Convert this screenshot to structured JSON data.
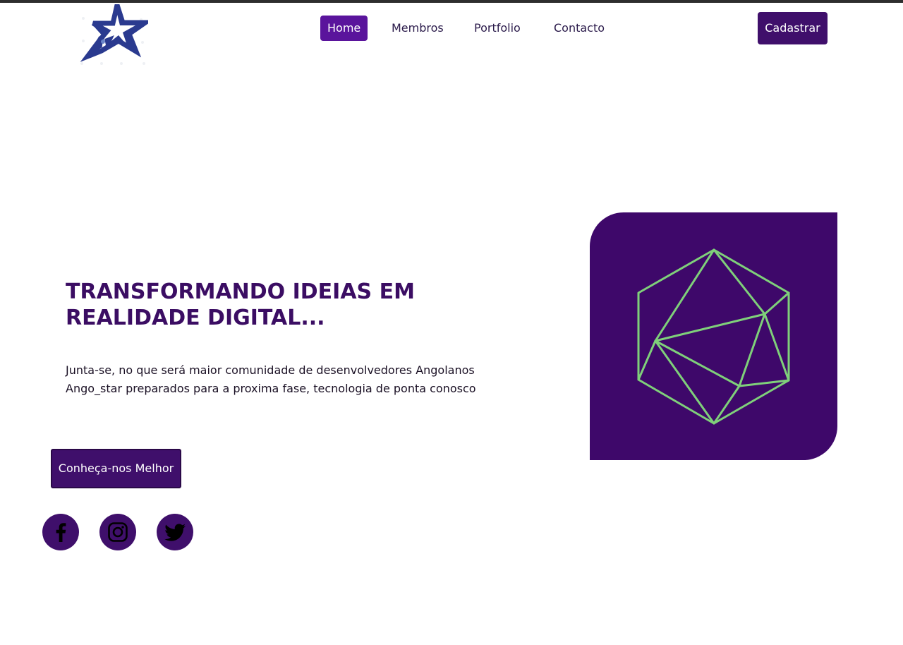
{
  "header": {
    "logo_icon": "star-logo-icon",
    "nav": [
      {
        "label": "Home",
        "active": true
      },
      {
        "label": "Membros",
        "active": false
      },
      {
        "label": "Portfolio",
        "active": false
      },
      {
        "label": "Contacto",
        "active": false
      }
    ],
    "signup_label": "Cadastrar"
  },
  "hero": {
    "title_line1": "TRANSFORMANDO IDEIAS EM",
    "title_line2": "REALIDADE DIGITAL...",
    "desc_line1": "Junta-se, no que será maior comunidade de desenvolvedores Angolanos",
    "desc_line2": "Ango_star preparados para a proxima fase, tecnologia de ponta conosco",
    "cta_label": "Conheça-nos Melhor",
    "art_icon": "geometric-polyhedron-icon"
  },
  "social": [
    {
      "icon": "facebook-icon"
    },
    {
      "icon": "instagram-icon"
    },
    {
      "icon": "twitter-icon"
    }
  ],
  "colors": {
    "brand_purple": "#3f0f6b",
    "nav_active": "#5a149c",
    "art_stroke": "#7fd07a",
    "logo_blue": "#2a3a8f"
  }
}
